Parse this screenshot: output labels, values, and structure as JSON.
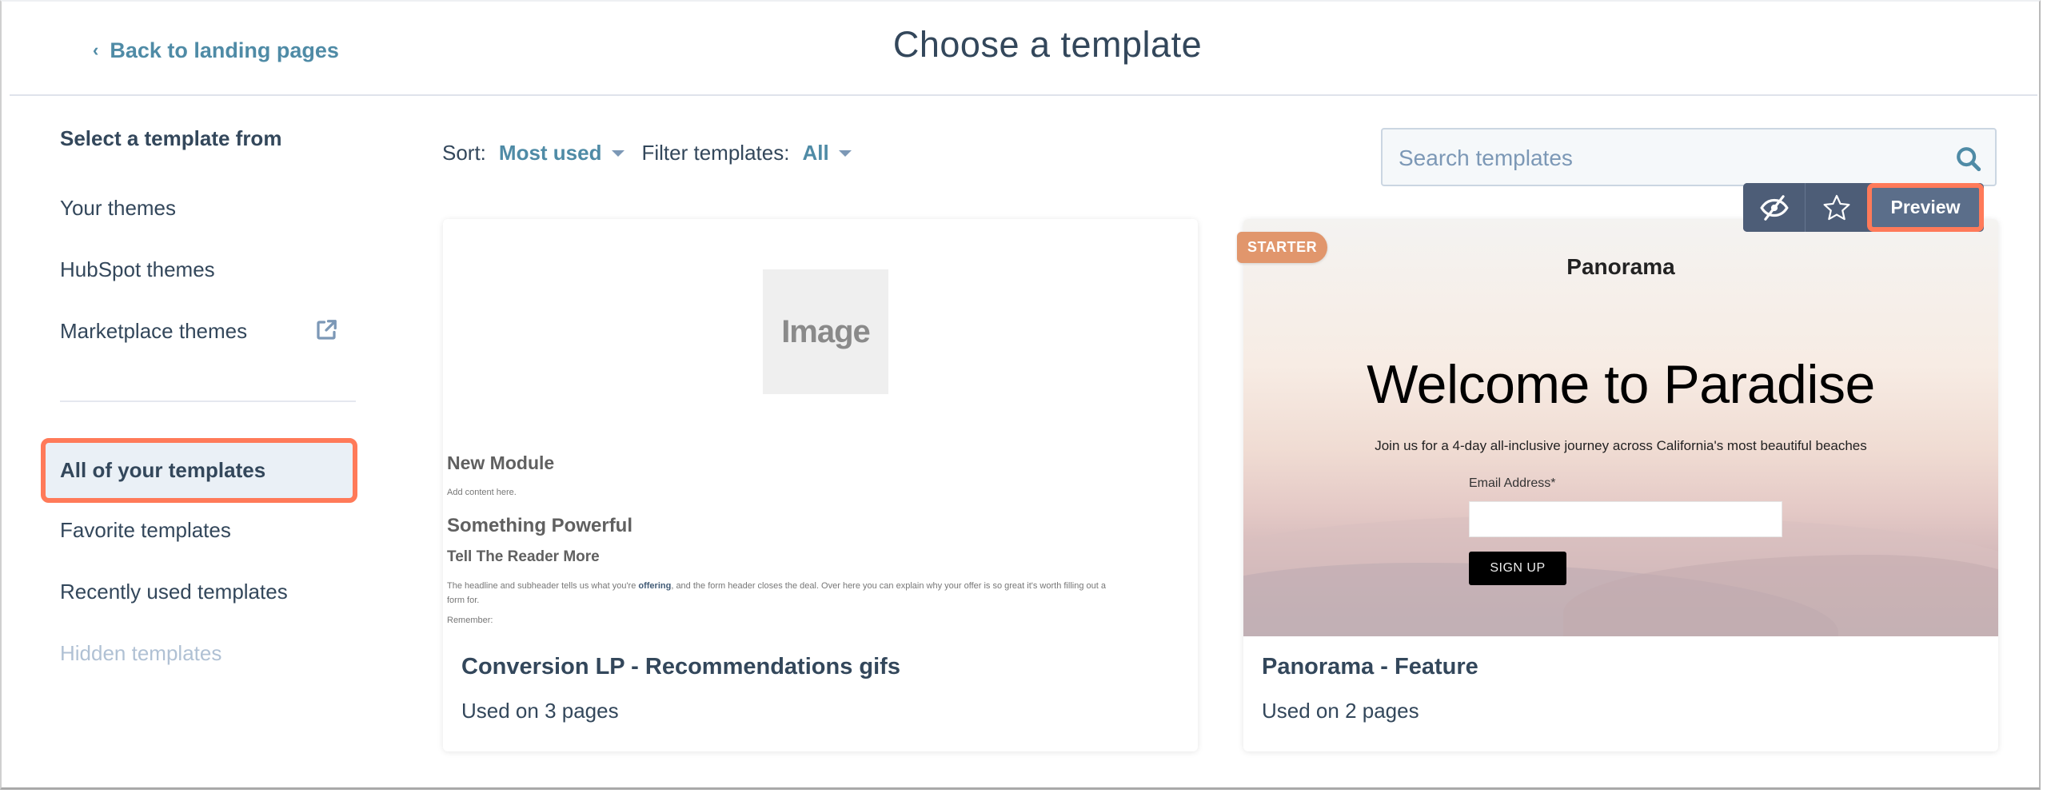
{
  "header": {
    "back_label": "Back to landing pages",
    "title": "Choose a template"
  },
  "sidebar": {
    "heading": "Select a template from",
    "sources": [
      {
        "label": "Your themes"
      },
      {
        "label": "HubSpot themes"
      },
      {
        "label": "Marketplace themes",
        "icon": "external-link-icon"
      }
    ],
    "collections": [
      {
        "label": "All of your templates",
        "active": true
      },
      {
        "label": "Favorite templates"
      },
      {
        "label": "Recently used templates"
      },
      {
        "label": "Hidden templates",
        "disabled": true
      }
    ]
  },
  "filters": {
    "sort_label": "Sort:",
    "sort_value": "Most used",
    "filter_label": "Filter templates:",
    "filter_value": "All"
  },
  "search": {
    "placeholder": "Search templates",
    "value": ""
  },
  "hover_toolbar": {
    "hide_icon": "eye-slash-icon",
    "favorite_icon": "star-outline-icon",
    "preview_label": "Preview"
  },
  "templates": [
    {
      "name": "Conversion LP - Recommendations gifs",
      "usage": "Used on 3 pages",
      "thumbnail": {
        "image_placeholder": "Image",
        "heading1": "New Module",
        "text1": "Add content here.",
        "heading2": "Something Powerful",
        "heading3": "Tell The Reader More",
        "body_before": "The headline and subheader tells us what you're ",
        "body_highlight": "offering",
        "body_after": ", and the form header closes the deal. Over here you can explain why your offer is so great it's worth filling out a form for.",
        "remember": "Remember:"
      }
    },
    {
      "name": "Panorama - Feature",
      "usage": "Used on 2 pages",
      "badge": "STARTER",
      "thumbnail": {
        "brand": "Panorama",
        "headline": "Welcome to Paradise",
        "subheadline": "Join us for a 4-day all-inclusive journey across California's most beautiful beaches",
        "field_label": "Email Address*",
        "button": "SIGN UP"
      }
    }
  ],
  "colors": {
    "accent_link": "#4f8ba6",
    "text_primary": "#33475b",
    "highlight_outline": "#ff7a59",
    "badge_starter": "#e1966c",
    "toolbar_bg": "#4d5d77"
  }
}
